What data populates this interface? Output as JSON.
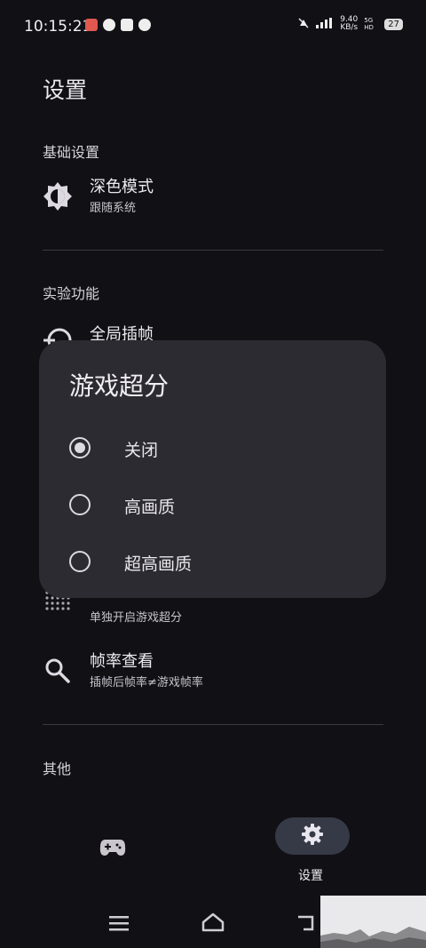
{
  "status": {
    "time": "10:15:21",
    "net_speed": "9.40",
    "net_unit": "KB/s",
    "signal": "5G HD",
    "battery": "27"
  },
  "page": {
    "title": "设置"
  },
  "sections": {
    "basic": {
      "label": "基础设置"
    },
    "dark_mode": {
      "title": "深色模式",
      "subtitle": "跟随系统"
    },
    "experimental": {
      "label": "实验功能"
    },
    "frame_interp": {
      "title": "全局插帧"
    },
    "single_sr": {
      "subtitle": "单独开启游戏超分"
    },
    "fps_view": {
      "title": "帧率查看",
      "subtitle": "插帧后帧率≠游戏帧率"
    },
    "other": {
      "label": "其他"
    }
  },
  "dialog": {
    "title": "游戏超分",
    "options": [
      {
        "label": "关闭",
        "selected": true
      },
      {
        "label": "高画质",
        "selected": false
      },
      {
        "label": "超高画质",
        "selected": false
      }
    ]
  },
  "nav": {
    "settings_label": "设置"
  },
  "colors": {
    "background": "#101015",
    "dialog": "#2c2b31",
    "nav_pill": "#363a47"
  }
}
